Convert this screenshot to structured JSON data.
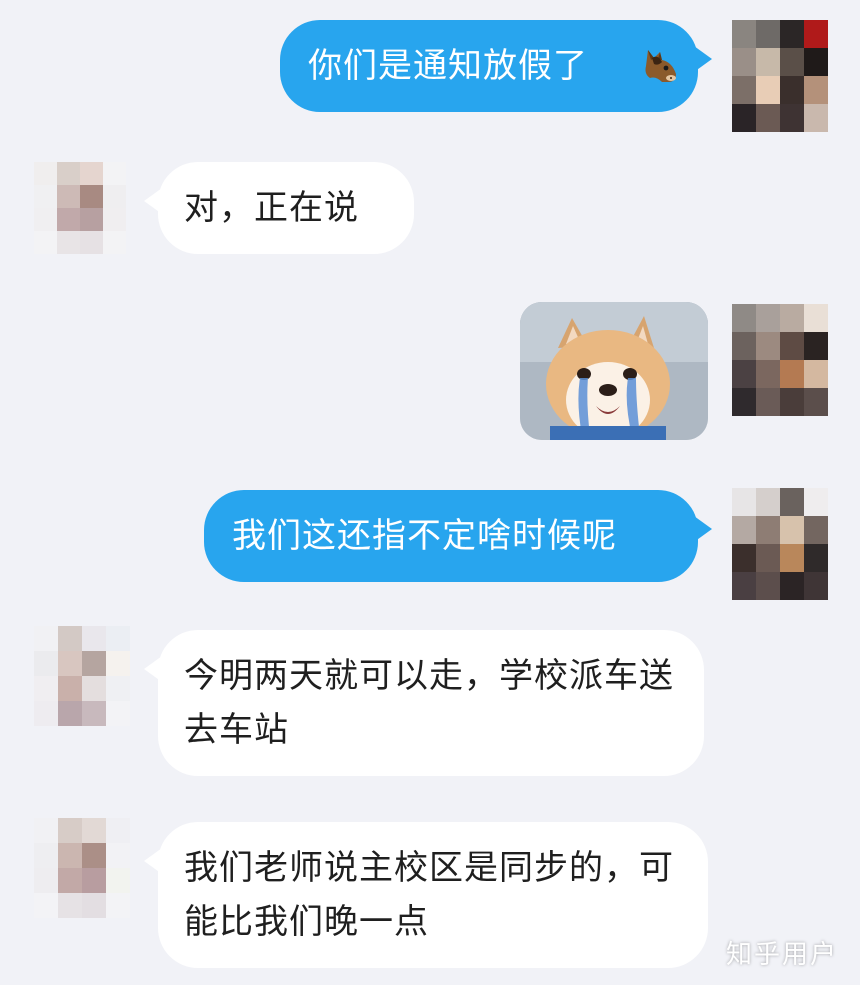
{
  "messages": [
    {
      "side": "right",
      "text": "你们是通知放假了",
      "emoji": "horse-face-emoji"
    },
    {
      "side": "left",
      "text": "对，正在说"
    },
    {
      "side": "right",
      "type": "sticker",
      "sticker": "shiba-crying-sticker"
    },
    {
      "side": "right",
      "text": "我们这还指不定啥时候呢"
    },
    {
      "side": "left",
      "text": "今明两天就可以走，学校派车送去车站"
    },
    {
      "side": "left",
      "text": "我们老师说主校区是同步的，可能比我们晚一点"
    }
  ],
  "watermark": "知乎用户",
  "colors": {
    "background": "#f1f2f7",
    "outgoing_bubble": "#28a5ee",
    "incoming_bubble": "#ffffff"
  }
}
